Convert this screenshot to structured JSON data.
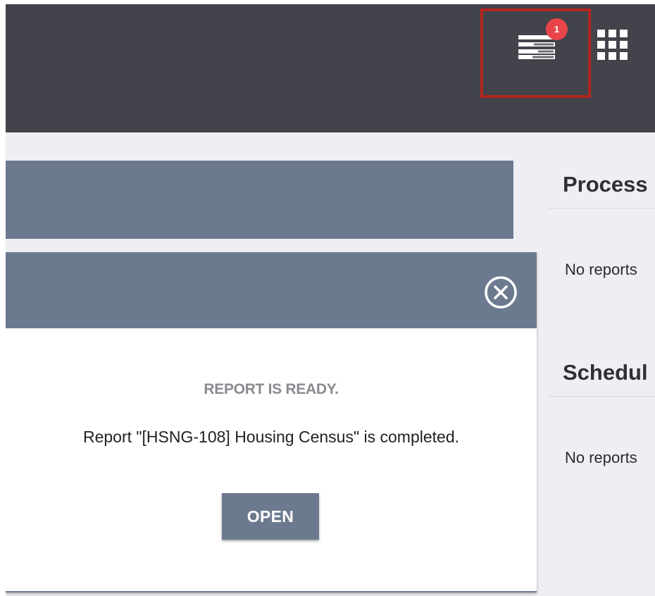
{
  "header": {
    "reports_badge_count": "1",
    "reports_icon": "reports-stack-icon",
    "apps_icon": "apps-grid-icon"
  },
  "right_panel": {
    "processing": {
      "title": "Process",
      "empty_text": "No reports"
    },
    "scheduled": {
      "title": "Schedul",
      "empty_text": "No reports"
    }
  },
  "dialog": {
    "close_icon": "close-circle-icon",
    "title": "REPORT IS READY.",
    "message": "Report \"[HSNG-108] Housing Census\" is completed.",
    "open_label": "OPEN"
  },
  "colors": {
    "header_bg": "#42434b",
    "panel_slate": "#6c7a8f",
    "badge_red": "#e8454a",
    "highlight_red": "#b3261e",
    "page_bg": "#efeff3"
  }
}
